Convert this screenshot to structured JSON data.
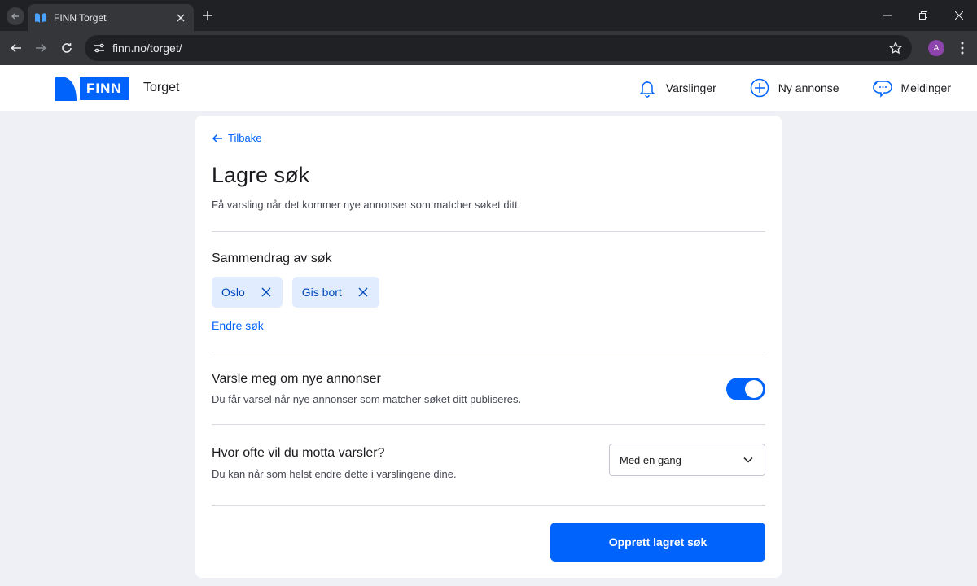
{
  "browser": {
    "tab_title": "FINN Torget",
    "url": "finn.no/torget/",
    "profile_initial": "A"
  },
  "header": {
    "logo_text": "FINN",
    "section": "Torget",
    "nav": [
      {
        "label": "Varslinger",
        "icon": "bell-icon"
      },
      {
        "label": "Ny annonse",
        "icon": "plus-circle-icon"
      },
      {
        "label": "Meldinger",
        "icon": "chat-icon"
      }
    ]
  },
  "card": {
    "back": "Tilbake",
    "title": "Lagre søk",
    "subtitle": "Få varsling når det kommer nye annonser som matcher søket ditt.",
    "summary": {
      "title": "Sammendrag av søk",
      "chips": [
        "Oslo",
        "Gis bort"
      ],
      "edit": "Endre søk"
    },
    "notify": {
      "title": "Varsle meg om nye annonser",
      "desc": "Du får varsel når nye annonser som matcher søket ditt publiseres.",
      "enabled": true
    },
    "frequency": {
      "title": "Hvor ofte vil du motta varsler?",
      "desc": "Du kan når som helst endre dette i varslingene dine.",
      "selected": "Med en gang"
    },
    "submit": "Opprett lagret søk"
  },
  "colors": {
    "brand": "#0063fb",
    "chip_bg": "#e1ecff"
  }
}
